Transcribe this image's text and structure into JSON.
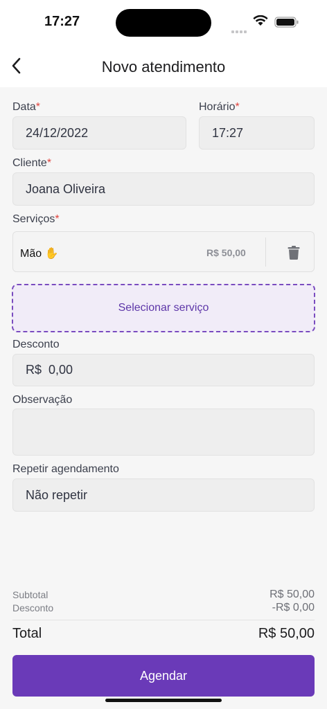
{
  "status_bar": {
    "time": "17:27"
  },
  "header": {
    "title": "Novo atendimento",
    "back_icon": "chevron-left-icon"
  },
  "form": {
    "date": {
      "label": "Data",
      "required_mark": "*",
      "value": "24/12/2022"
    },
    "time": {
      "label": "Horário",
      "required_mark": "*",
      "value": "17:27"
    },
    "client": {
      "label": "Cliente",
      "required_mark": "*",
      "value": "Joana Oliveira"
    },
    "services": {
      "label": "Serviços",
      "required_mark": "*",
      "items": [
        {
          "name": "Mão ✋",
          "price": "R$ 50,00",
          "delete_icon": "trash-icon"
        }
      ],
      "select_label": "Selecionar serviço"
    },
    "discount": {
      "label": "Desconto",
      "value": "R$  0,00"
    },
    "note": {
      "label": "Observação",
      "value": ""
    },
    "repeat": {
      "label": "Repetir agendamento",
      "value": "Não repetir"
    }
  },
  "summary": {
    "subtotal_label": "Subtotal",
    "subtotal_value": "R$ 50,00",
    "discount_label": "Desconto",
    "discount_value": "-R$ 0,00",
    "total_label": "Total",
    "total_value": "R$ 50,00"
  },
  "cta": {
    "label": "Agendar"
  },
  "colors": {
    "accent": "#6a3ab8",
    "required": "#e0443e",
    "field_bg": "#eeeeee"
  }
}
